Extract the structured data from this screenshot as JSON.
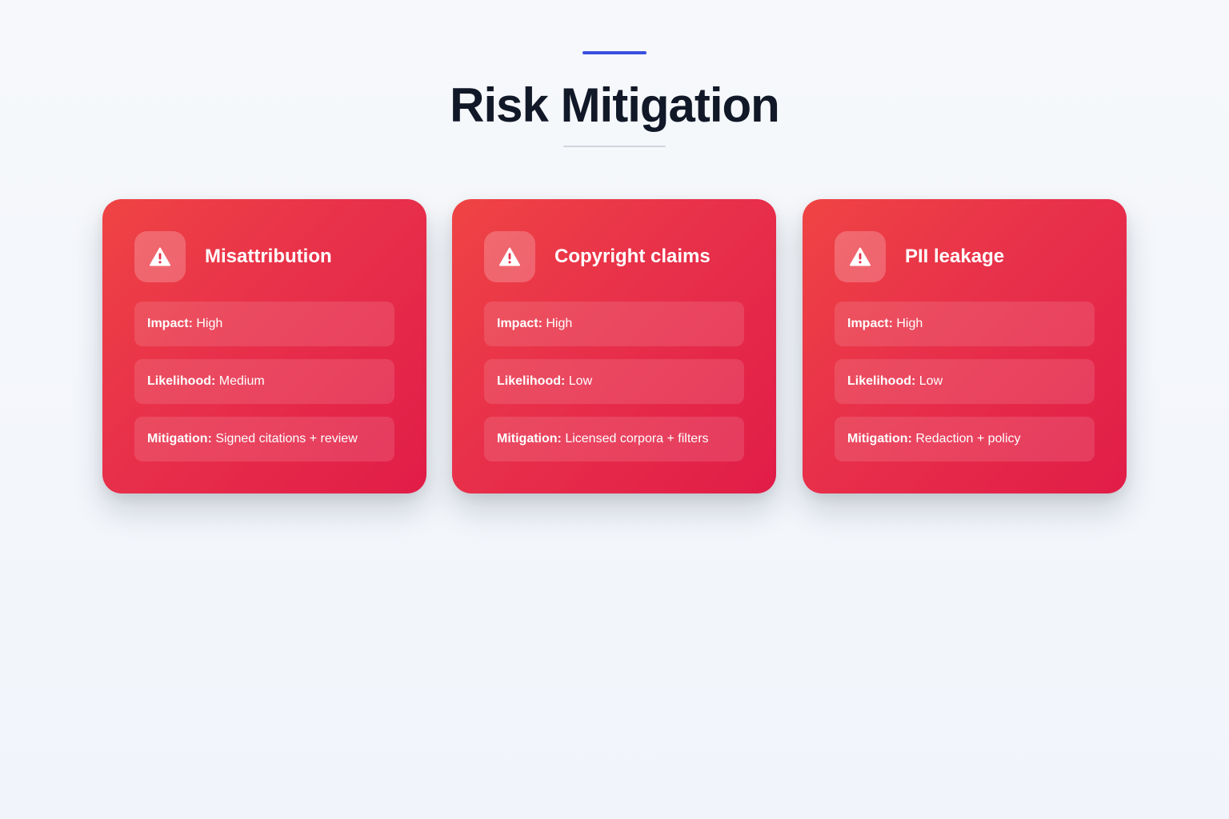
{
  "page": {
    "title": "Risk Mitigation"
  },
  "colors": {
    "accent": "#3b4fe0",
    "card_red_start": "#ef4444",
    "card_red_end": "#e11d48"
  },
  "cards": [
    {
      "icon": "warning-triangle-icon",
      "title": "Misattribution",
      "rows": [
        {
          "label": "Impact:",
          "value": "High"
        },
        {
          "label": "Likelihood:",
          "value": "Medium"
        },
        {
          "label": "Mitigation:",
          "value": "Signed citations + review"
        }
      ]
    },
    {
      "icon": "warning-triangle-icon",
      "title": "Copyright claims",
      "rows": [
        {
          "label": "Impact:",
          "value": "High"
        },
        {
          "label": "Likelihood:",
          "value": "Low"
        },
        {
          "label": "Mitigation:",
          "value": "Licensed corpora + filters"
        }
      ]
    },
    {
      "icon": "warning-triangle-icon",
      "title": "PII leakage",
      "rows": [
        {
          "label": "Impact:",
          "value": "High"
        },
        {
          "label": "Likelihood:",
          "value": "Low"
        },
        {
          "label": "Mitigation:",
          "value": "Redaction + policy"
        }
      ]
    }
  ]
}
